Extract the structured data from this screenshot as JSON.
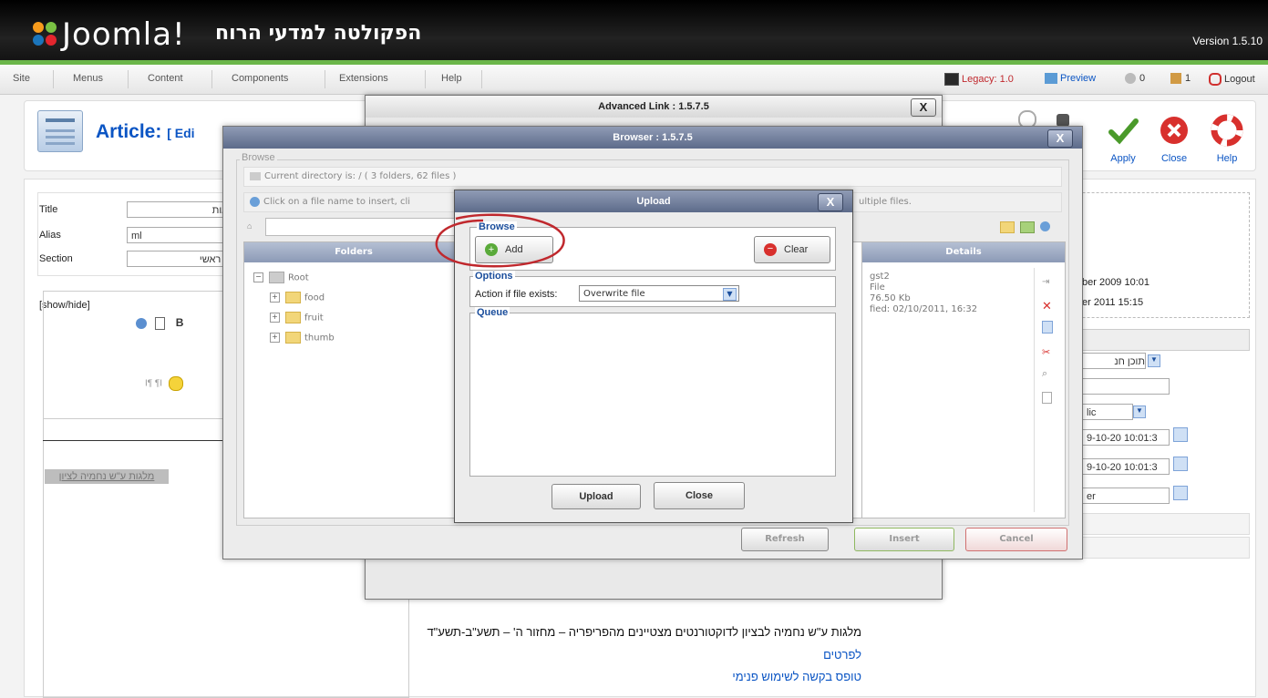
{
  "header": {
    "logo": "Joomla!",
    "site_name": "הפקולטה למדעי הרוח",
    "version": "Version 1.5.10"
  },
  "menu": {
    "items": [
      "Site",
      "Menus",
      "Content",
      "Components",
      "Extensions",
      "Help"
    ],
    "legacy": "Legacy: 1.0",
    "preview": "Preview",
    "messages": "0",
    "users": "1",
    "logout": "Logout"
  },
  "toolbar": {
    "title_prefix": "Article:",
    "title_action": "[ Edi",
    "apply": "Apply",
    "close": "Close",
    "help": "Help"
  },
  "form": {
    "title_label": "Title",
    "title_value": "חוגות",
    "alias_label": "Alias",
    "alias_value": "ml",
    "section_label": "Section",
    "section_value": "דף ראשי",
    "show_hide": "[show/hide]",
    "highlighted_text": "מלגות ע\"ש נחמיה לציון",
    "body_line1": "מלגות ע\"ש נחמיה לבציון לדוקטורנטים מצטיינים מהפריפריה – מחזור ה' – תשע\"ב-תשע\"ד",
    "body_line2": "לפרטים",
    "body_line3": "טופס בקשה לשימוש פנימי"
  },
  "right_panel": {
    "created": "ber 2009 10:01",
    "modified": "er 2011 15:15",
    "select1": "תוכן חנ",
    "select2": "lic",
    "date1": "9-10-20 10:01:3",
    "date2": "9-10-20 10:01:3",
    "date3": "er"
  },
  "advanced_link": {
    "title": "Advanced Link : 1.5.7.5",
    "close": "X"
  },
  "browser": {
    "title": "Browser : 1.5.7.5",
    "close": "X",
    "browse_legend": "Browse",
    "current_dir": "Current directory is: / ( 3 folders, 62 files )",
    "hint_left": "Click on a file name to insert, cli",
    "hint_right": "ultiple files.",
    "folders_header": "Folders",
    "details_header": "Details",
    "tree": [
      "Root",
      "food",
      "fruit",
      "thumb"
    ],
    "details": [
      "gst2",
      "File",
      "76.50 Kb",
      "fied: 02/10/2011, 16:32"
    ],
    "refresh": "Refresh",
    "insert": "Insert",
    "cancel": "Cancel"
  },
  "upload": {
    "title": "Upload",
    "close": "X",
    "browse_legend": "Browse",
    "add": "Add",
    "clear": "Clear",
    "options_legend": "Options",
    "action_label": "Action if file exists:",
    "action_value": "Overwrite file",
    "queue_legend": "Queue",
    "upload_btn": "Upload",
    "close_btn": "Close"
  },
  "colors": {
    "accent_green": "#6bb64a",
    "link_blue": "#0b55c4",
    "annotation_red": "#c0282d"
  }
}
